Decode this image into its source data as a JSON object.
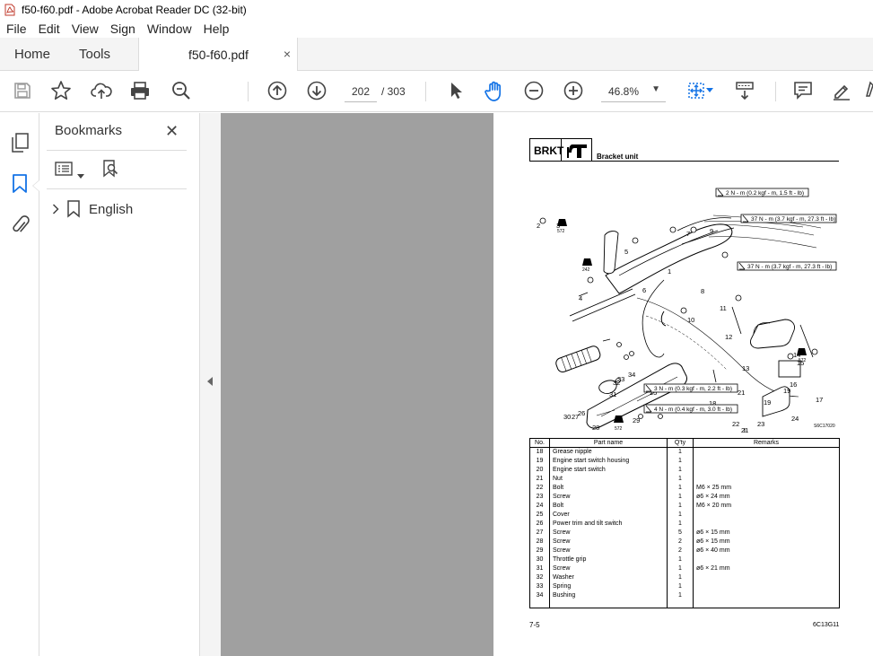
{
  "window": {
    "title": "f50-f60.pdf - Adobe Acrobat Reader DC (32-bit)"
  },
  "menu": [
    "File",
    "Edit",
    "View",
    "Sign",
    "Window",
    "Help"
  ],
  "tabs": {
    "home": "Home",
    "tools": "Tools",
    "document": "f50-f60.pdf",
    "close": "×"
  },
  "toolbar": {
    "page_current": "202",
    "page_total": "/ 303",
    "zoom": "46.8%"
  },
  "icons": {
    "save": "save-icon",
    "bookmark": "star-icon",
    "upload": "cloud-upload-icon",
    "print": "print-icon",
    "find": "zoom-search-icon",
    "prev": "arrow-up-circle-icon",
    "next": "arrow-down-circle-icon",
    "select": "cursor-icon",
    "hand": "hand-icon",
    "zoom_out": "zoom-out-icon",
    "zoom_in": "zoom-in-icon",
    "fit": "fit-page-icon",
    "scroll": "scroll-mode-icon",
    "comment": "comment-icon",
    "highlight": "pen-icon"
  },
  "bookmarks": {
    "title": "Bookmarks",
    "close": "✕",
    "items": [
      {
        "label": "English"
      }
    ]
  },
  "page": {
    "section": "BRKT",
    "title": "Bracket unit",
    "diagram_code": "S6C17020",
    "torques": [
      "2 N - m (0.2 kgf - m, 1.5 ft - lb)",
      "37 N - m (3.7 kgf - m, 27.3 ft - lb)",
      "37 N - m (3.7 kgf - m, 27.3 ft - lb)",
      "3 N - m (0.3 kgf - m, 2.2 ft - lb)",
      "4 N - m (0.4 kgf - m, 3.0 ft - lb)"
    ],
    "callouts": {
      "c1": "1",
      "c2": "2",
      "c3": "3",
      "c4": "4",
      "c5": "5",
      "c6": "6",
      "c7": "7",
      "c8": "8",
      "c9": "9",
      "c10": "10",
      "c11": "11",
      "c12": "12",
      "c13": "13",
      "c14": "14",
      "c15": "15",
      "c16": "16",
      "c17": "17",
      "c18": "18",
      "c19": "19",
      "c20": "20",
      "c21a": "21",
      "c21b": "21",
      "c22": "22",
      "c23": "23",
      "c24": "24",
      "c25": "25",
      "c26": "26",
      "c27": "27",
      "c28": "28",
      "c29": "29",
      "c30": "30",
      "c31": "31",
      "c32": "32",
      "c33": "33",
      "c34": "34"
    },
    "sealant_labels": {
      "s1": "572",
      "s2": "242",
      "s3": "572",
      "s4": "572"
    },
    "table": {
      "headers": [
        "No.",
        "Part name",
        "Q'ty",
        "Remarks"
      ],
      "rows": [
        [
          "18",
          "Grease nipple",
          "1",
          ""
        ],
        [
          "19",
          "Engine start switch housing",
          "1",
          ""
        ],
        [
          "20",
          "Engine start switch",
          "1",
          ""
        ],
        [
          "21",
          "Nut",
          "1",
          ""
        ],
        [
          "22",
          "Bolt",
          "1",
          "M6 × 25 mm"
        ],
        [
          "23",
          "Screw",
          "1",
          "ø6 × 24 mm"
        ],
        [
          "24",
          "Bolt",
          "1",
          "M6 × 20 mm"
        ],
        [
          "25",
          "Cover",
          "1",
          ""
        ],
        [
          "26",
          "Power trim and tilt switch",
          "1",
          ""
        ],
        [
          "27",
          "Screw",
          "5",
          "ø6 × 15 mm"
        ],
        [
          "28",
          "Screw",
          "2",
          "ø6 × 15 mm"
        ],
        [
          "29",
          "Screw",
          "2",
          "ø6 × 40 mm"
        ],
        [
          "30",
          "Throttle grip",
          "1",
          ""
        ],
        [
          "31",
          "Screw",
          "1",
          "ø6 × 21 mm"
        ],
        [
          "32",
          "Washer",
          "1",
          ""
        ],
        [
          "33",
          "Spring",
          "1",
          ""
        ],
        [
          "34",
          "Bushing",
          "1",
          ""
        ]
      ]
    },
    "footer_left": "7-5",
    "footer_right": "6C13G11"
  }
}
